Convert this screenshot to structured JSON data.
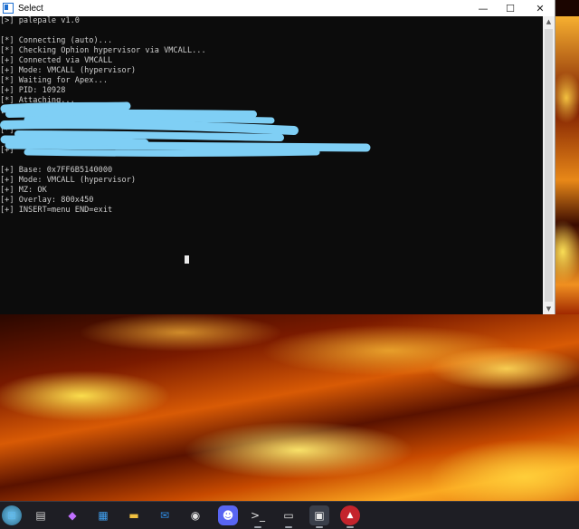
{
  "window": {
    "title": "Select",
    "controls": {
      "minimize": "—",
      "maximize": "☐",
      "close": "✕"
    }
  },
  "console": {
    "lines": [
      "[>] palepale v1.0",
      "",
      "[*] Connecting (auto)...",
      "[*] Checking Ophion hypervisor via VMCALL...",
      "[+] Connected via VMCALL",
      "[+] Mode: VMCALL (hypervisor)",
      "[*] Waiting for Apex...",
      "[+] PID: 10928",
      "[*] Attaching...",
      "[+]",
      "",
      "[*]",
      "",
      "[+]",
      "",
      "[+] Base: 0x7FF6B5140000",
      "[+] Mode: VMCALL (hypervisor)",
      "[+] MZ: OK",
      "[+] Overlay: 800x450",
      "[+] INSERT=menu END=exit"
    ]
  },
  "scrollbar": {
    "up": "▲",
    "down": "▼"
  },
  "taskbar": {
    "items": [
      {
        "name": "start-icon",
        "glyph": "⊞",
        "color": "#5fb6e8"
      },
      {
        "name": "task-view-icon",
        "glyph": "▤",
        "color": "#d0d0d0"
      },
      {
        "name": "copilot-icon",
        "glyph": "◆",
        "color": "#c070ff"
      },
      {
        "name": "store-icon",
        "glyph": "▦",
        "color": "#40a0f0"
      },
      {
        "name": "file-explorer-icon",
        "glyph": "▬",
        "color": "#f0c040"
      },
      {
        "name": "mail-icon",
        "glyph": "✉",
        "color": "#2f8ae0"
      },
      {
        "name": "obs-icon",
        "glyph": "◉",
        "color": "#e0e0e0"
      },
      {
        "name": "discord-icon",
        "glyph": "☻",
        "color": "#ffffff"
      },
      {
        "name": "terminal-icon",
        "glyph": ">_",
        "color": "#e0e0e0"
      },
      {
        "name": "console-icon",
        "glyph": "▭",
        "color": "#e0e0e0"
      },
      {
        "name": "app-window-icon",
        "glyph": "▣",
        "color": "#e8e8e8"
      },
      {
        "name": "game-icon",
        "glyph": "▲",
        "color": "#ffffff"
      }
    ]
  }
}
